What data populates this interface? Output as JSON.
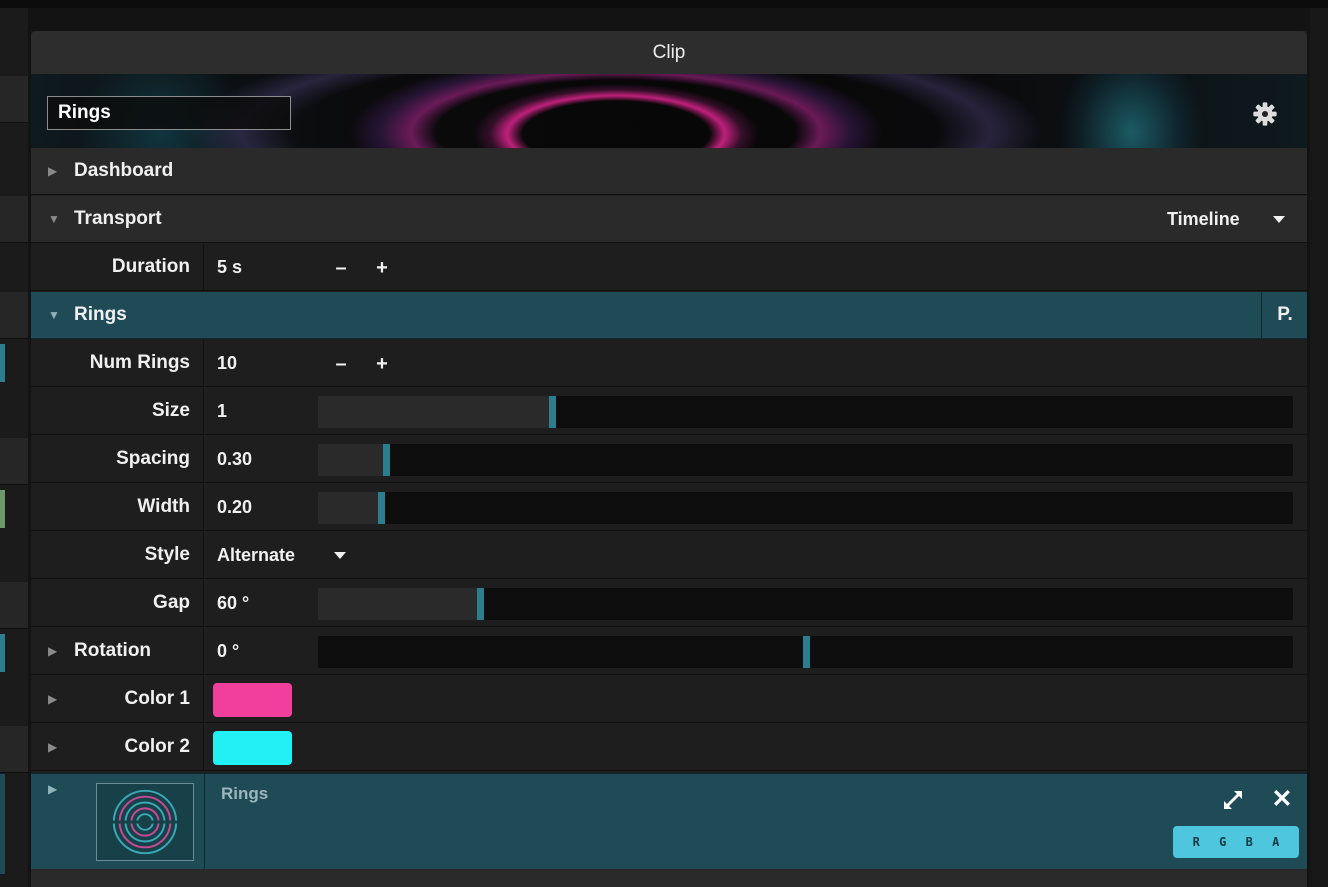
{
  "panel": {
    "title": "Clip"
  },
  "clip": {
    "name": "Rings"
  },
  "sections": {
    "dashboard": {
      "label": "Dashboard"
    },
    "transport": {
      "label": "Transport",
      "mode": "Timeline"
    },
    "rings": {
      "label": "Rings",
      "p_button": "P."
    }
  },
  "params": {
    "duration": {
      "label": "Duration",
      "value": "5 s",
      "minus": "–",
      "plus": "+"
    },
    "num_rings": {
      "label": "Num Rings",
      "value": "10",
      "minus": "–",
      "plus": "+"
    },
    "size": {
      "label": "Size",
      "value": "1",
      "slider_fraction": 0.24
    },
    "spacing": {
      "label": "Spacing",
      "value": "0.30",
      "slider_fraction": 0.07
    },
    "width": {
      "label": "Width",
      "value": "0.20",
      "slider_fraction": 0.065
    },
    "style": {
      "label": "Style",
      "value": "Alternate"
    },
    "gap": {
      "label": "Gap",
      "value": "60 °",
      "slider_fraction": 0.166
    },
    "rotation": {
      "label": "Rotation",
      "value": "0 °",
      "slider_fraction": 0.5
    },
    "color1": {
      "label": "Color 1",
      "color": "#f23e9c"
    },
    "color2": {
      "label": "Color 2",
      "color": "#21f0f5"
    }
  },
  "layer": {
    "name": "Rings",
    "close": "✕",
    "channels": [
      "R",
      "G",
      "B",
      "A"
    ]
  },
  "colors": {
    "accent_teal": "#1e4b56",
    "slider_thumb": "#2c7d8e",
    "rgba_badge": "#4dc6de"
  },
  "icons": {
    "gear": "gear-icon",
    "dropdown": "chevron-down-icon",
    "expand": "expand-icon",
    "close": "close-icon"
  }
}
